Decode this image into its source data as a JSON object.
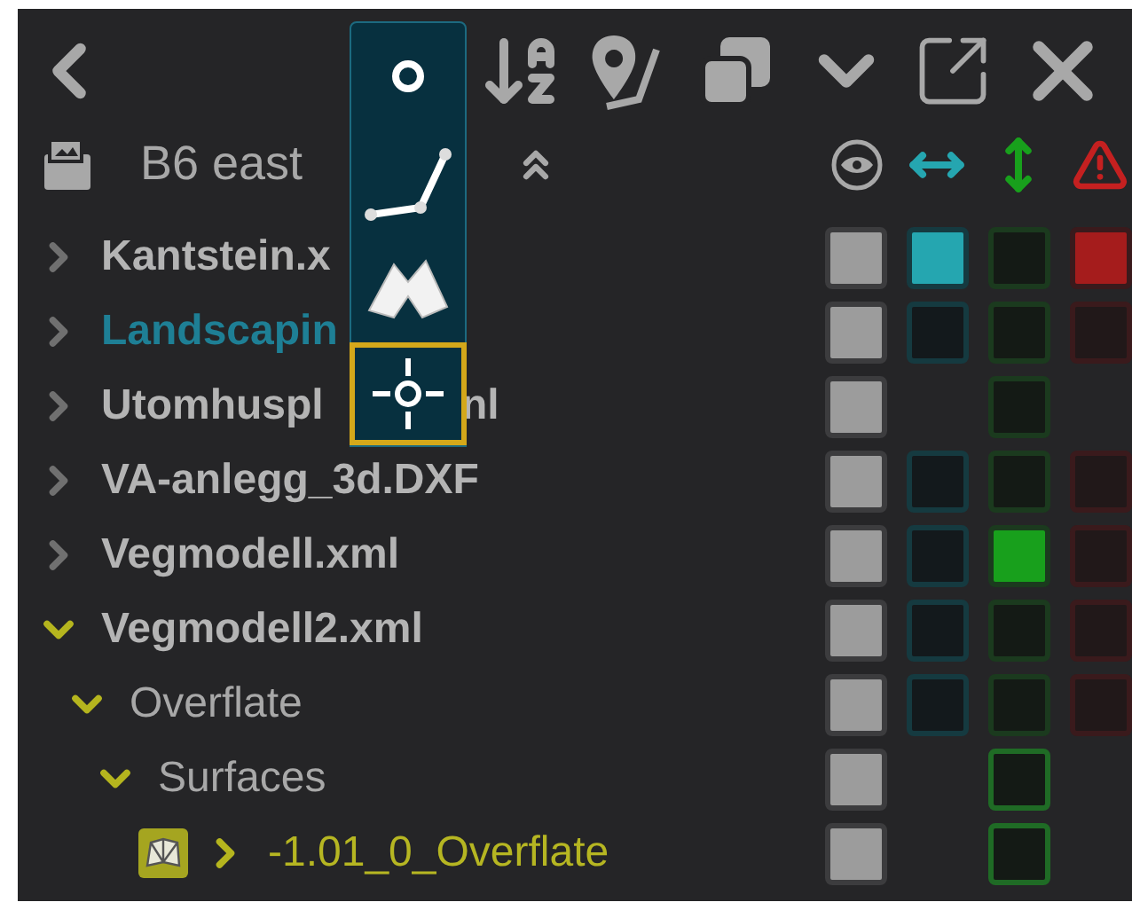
{
  "toolbar": {
    "tools": [
      {
        "kind": "point",
        "selected": false
      },
      {
        "kind": "polyline",
        "selected": false
      },
      {
        "kind": "area",
        "selected": false
      },
      {
        "kind": "crosshair",
        "selected": true
      }
    ]
  },
  "header": {
    "title": "B6 east"
  },
  "tree": [
    {
      "label": "Kantstein.x",
      "kind": "file",
      "color": "#b4b4b4",
      "expanded": false,
      "cells": {
        "visible": true,
        "horizontal": true,
        "vertical": false,
        "warning": true
      }
    },
    {
      "label": "Landscapin",
      "kind": "file",
      "color": "#1e7f95",
      "expanded": false,
      "cells": {
        "visible": true,
        "horizontal": false,
        "vertical": false,
        "warning": false
      }
    },
    {
      "label": "Utomhuspl",
      "label_tail": "nl",
      "kind": "file",
      "color": "#b4b4b4",
      "expanded": false,
      "cells": {
        "visible": true,
        "vertical": false
      }
    },
    {
      "label": "VA-anlegg_3d.DXF",
      "kind": "file",
      "color": "#b4b4b4",
      "expanded": false,
      "cells": {
        "visible": true,
        "horizontal": false,
        "vertical": false,
        "warning": false
      }
    },
    {
      "label": "Vegmodell.xml",
      "kind": "file",
      "color": "#b4b4b4",
      "expanded": false,
      "cells": {
        "visible": true,
        "horizontal": false,
        "vertical": true,
        "warning": false
      }
    },
    {
      "label": "Vegmodell2.xml",
      "kind": "file",
      "color": "#b4b4b4",
      "expanded": true,
      "cells": {
        "visible": true,
        "horizontal": false,
        "vertical": false,
        "warning": false
      },
      "children": [
        {
          "label": "Overflate",
          "kind": "group",
          "color": "#a8a8a8",
          "expanded": true,
          "cells": {
            "visible": true,
            "horizontal": false,
            "vertical": false,
            "warning": false
          },
          "children": [
            {
              "label": "Surfaces",
              "kind": "group",
              "color": "#a8a8a8",
              "expanded": true,
              "cells": {
                "visible": true,
                "vertical": false
              },
              "children": [
                {
                  "label": "-1.01_0_Overflate",
                  "kind": "surface",
                  "color": "#b6b622",
                  "expanded": false,
                  "cells": {
                    "visible": true,
                    "vertical": false
                  }
                }
              ]
            }
          ]
        }
      ]
    }
  ]
}
